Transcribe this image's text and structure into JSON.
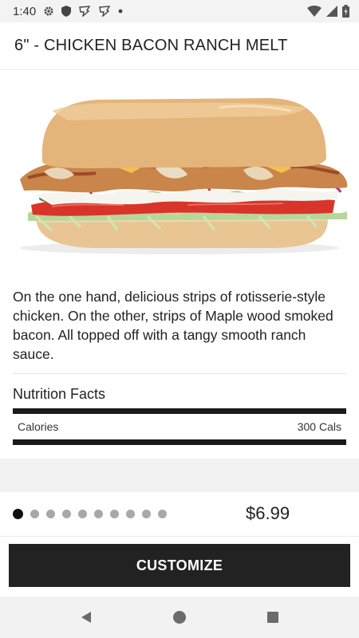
{
  "status_bar": {
    "time": "1:40",
    "icons": [
      "gear-icon",
      "shield-icon",
      "app-notification-icon",
      "app-notification-icon",
      "more-dot-icon",
      "wifi-icon",
      "cell-signal-icon",
      "battery-charging-icon"
    ]
  },
  "header": {
    "title": "6\" - CHICKEN BACON RANCH MELT"
  },
  "product": {
    "image": "chicken-bacon-ranch-sandwich-image",
    "description": "On the one hand, delicious strips of rotisserie-style chicken. On the other, strips of Maple wood smoked bacon. All topped off with a tangy smooth ranch sauce."
  },
  "nutrition": {
    "title": "Nutrition Facts",
    "rows": [
      {
        "label": "Calories",
        "value": "300 Cals"
      }
    ]
  },
  "pager": {
    "total_pages": 10,
    "active_index": 0,
    "price": "$6.99"
  },
  "actions": {
    "customize_label": "CUSTOMIZE"
  },
  "nav_bar": {
    "icons": [
      "back-icon",
      "home-icon",
      "recents-icon"
    ]
  },
  "colors": {
    "button_bg": "#222222",
    "dot_active": "#111111",
    "dot_inactive": "#a8a8a8",
    "band_gray": "#f2f2f2"
  }
}
